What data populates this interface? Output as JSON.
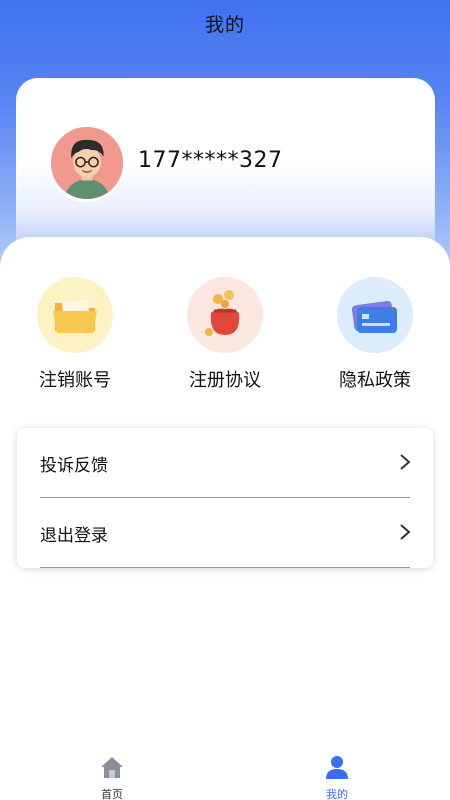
{
  "header": {
    "title": "我的"
  },
  "profile": {
    "phone": "177*****327",
    "avatar_icon": "avatar-icon"
  },
  "quick_actions": [
    {
      "label": "注销账号",
      "icon": "folder-icon"
    },
    {
      "label": "注册协议",
      "icon": "money-bag-icon"
    },
    {
      "label": "隐私政策",
      "icon": "card-icon"
    }
  ],
  "menu": [
    {
      "label": "投诉反馈",
      "icon": "chevron-right-icon"
    },
    {
      "label": "退出登录",
      "icon": "chevron-right-icon"
    }
  ],
  "tabbar": {
    "items": [
      {
        "label": "首页",
        "icon": "home-icon"
      },
      {
        "label": "我的",
        "icon": "user-icon",
        "active": true
      }
    ]
  },
  "colors": {
    "accent": "#3a6df0",
    "header_gradient_top": "#3f72f0"
  }
}
